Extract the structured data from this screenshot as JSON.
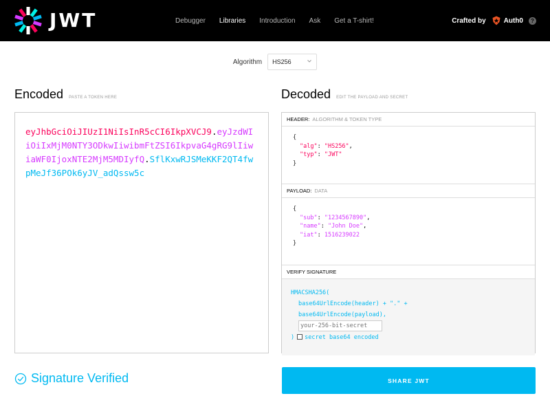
{
  "header": {
    "logo_text": "JWT",
    "nav": [
      "Debugger",
      "Libraries",
      "Introduction",
      "Ask",
      "Get a T-shirt!"
    ],
    "crafted_by": "Crafted by",
    "brand": "Auth0",
    "help": "?"
  },
  "algorithm": {
    "label": "Algorithm",
    "selected": "HS256"
  },
  "encoded": {
    "title": "Encoded",
    "subtitle": "PASTE A TOKEN HERE",
    "token_header": "eyJhbGciOiJIUzI1NiIsInR5cCI6IkpXVCJ9",
    "token_payload": "eyJzdWIiOiIxMjM0NTY3ODkwIiwibmFtZSI6IkpvaG4gRG9lIiwiaWF0IjoxNTE2MjM5MDIyfQ",
    "token_signature": "SflKxwRJSMeKKF2QT4fwpMeJf36POk6yJV_adQssw5c",
    "dot": "."
  },
  "decoded": {
    "title": "Decoded",
    "subtitle": "EDIT THE PAYLOAD AND SECRET",
    "header_section": {
      "label": "HEADER:",
      "sub": "ALGORITHM & TOKEN TYPE"
    },
    "header_json": {
      "open": "{",
      "alg_key": "\"alg\"",
      "alg_val": "\"HS256\"",
      "typ_key": "\"typ\"",
      "typ_val": "\"JWT\"",
      "close": "}"
    },
    "payload_section": {
      "label": "PAYLOAD:",
      "sub": "DATA"
    },
    "payload_json": {
      "open": "{",
      "sub_key": "\"sub\"",
      "sub_val": "\"1234567890\"",
      "name_key": "\"name\"",
      "name_val": "\"John Doe\"",
      "iat_key": "\"iat\"",
      "iat_val": "1516239022",
      "close": "}"
    },
    "verify_section": {
      "label": "VERIFY SIGNATURE"
    },
    "verify": {
      "fn_open": "HMACSHA256(",
      "line1": "base64UrlEncode(header) + \".\" +",
      "line2": "base64UrlEncode(payload),",
      "secret_placeholder": "your-256-bit-secret",
      "close": ")",
      "checkbox_label": "secret base64 encoded"
    }
  },
  "footer": {
    "verified_text": "Signature Verified",
    "share_label": "SHARE JWT"
  },
  "colors": {
    "header": "#fb015b",
    "payload": "#d63aff",
    "signature": "#00b9f1",
    "accent": "#00b9f1"
  }
}
